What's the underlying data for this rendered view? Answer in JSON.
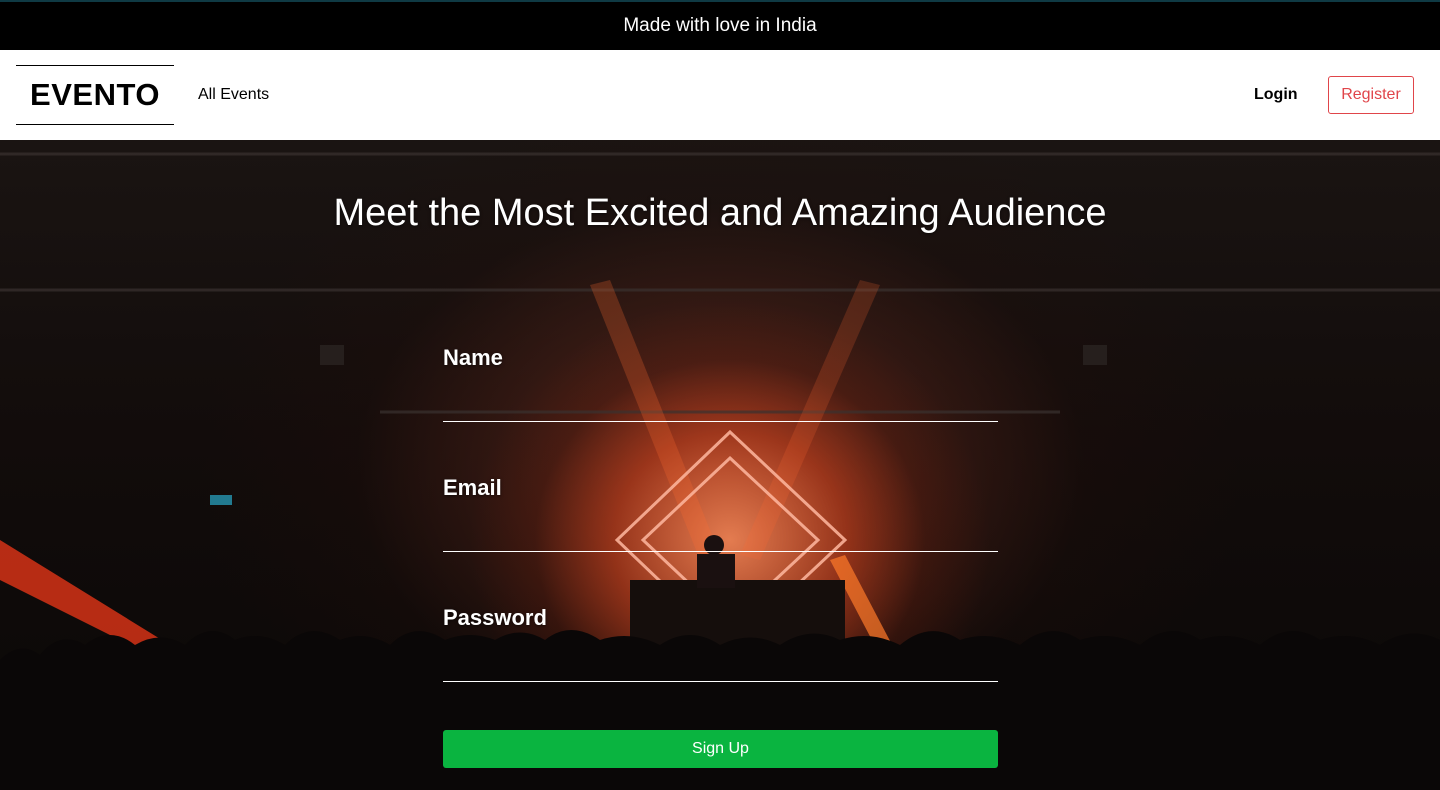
{
  "banner": {
    "text": "Made with love in India"
  },
  "navbar": {
    "logo": "EVENTO",
    "links": {
      "all_events": "All Events"
    },
    "login": "Login",
    "register": "Register"
  },
  "hero": {
    "title": "Meet the Most Excited and Amazing Audience",
    "form": {
      "name_label": "Name",
      "name_value": "",
      "email_label": "Email",
      "email_value": "",
      "password_label": "Password",
      "password_value": "",
      "submit_label": "Sign Up"
    }
  },
  "colors": {
    "banner_bg": "#000000",
    "register_accent": "#e0454a",
    "signup_bg": "#0ab440"
  }
}
